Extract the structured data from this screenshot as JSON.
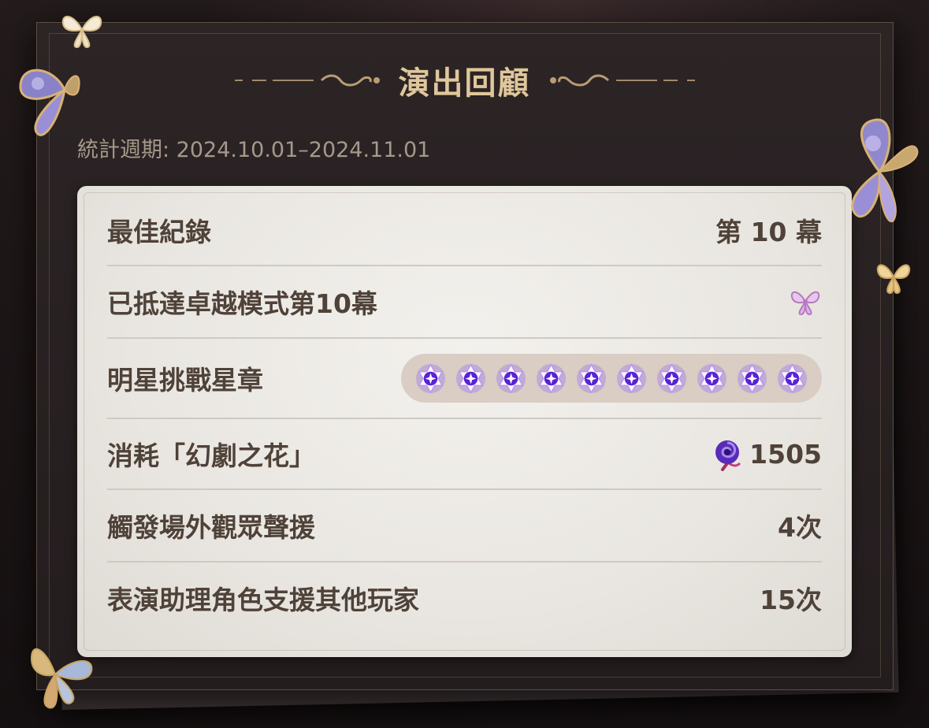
{
  "header": {
    "title": "演出回顧"
  },
  "period": {
    "text": "統計週期: 2024.10.01–2024.11.01"
  },
  "stats": {
    "best_record": {
      "label": "最佳紀錄",
      "value": "第 10 幕"
    },
    "reached_mode": {
      "label": "已抵達卓越模式第10幕",
      "icon": "butterfly-emblem-icon"
    },
    "star_badges": {
      "label": "明星挑戰星章",
      "count": 10,
      "icon": "star-badge-icon"
    },
    "consumed": {
      "label": "消耗「幻劇之花」",
      "icon": "fantasia-flower-icon",
      "value": "1505"
    },
    "audience_support": {
      "label": "觸發場外觀眾聲援",
      "value": "4次"
    },
    "assist_players": {
      "label": "表演助理角色支援其他玩家",
      "value": "15次"
    }
  },
  "colors": {
    "title": "#dfc79b",
    "period": "#a6998a",
    "card_text": "#4f4239",
    "badge_strip": "#d9cdc4",
    "badge_purple": "#7a3fe0"
  }
}
